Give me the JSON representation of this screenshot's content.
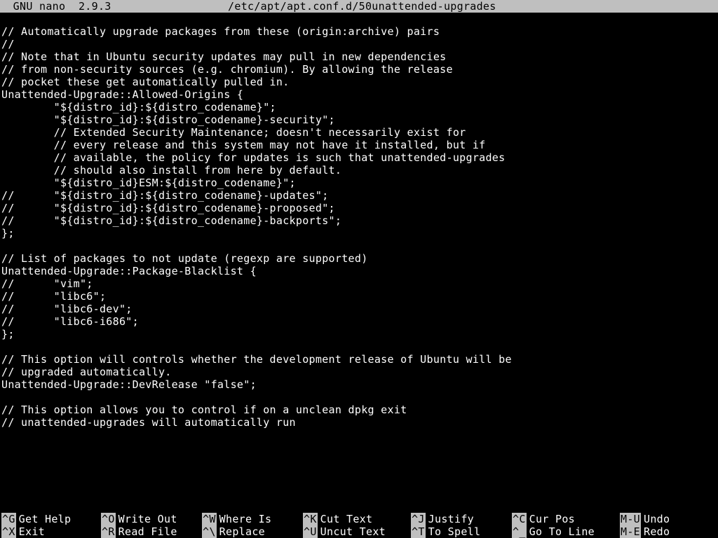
{
  "title": {
    "app": "  GNU nano  2.9.3",
    "filename": "/etc/apt/apt.conf.d/50unattended-upgrades"
  },
  "buffer_lines": [
    "",
    "// Automatically upgrade packages from these (origin:archive) pairs",
    "//",
    "// Note that in Ubuntu security updates may pull in new dependencies",
    "// from non-security sources (e.g. chromium). By allowing the release",
    "// pocket these get automatically pulled in.",
    "Unattended-Upgrade::Allowed-Origins {",
    "        \"${distro_id}:${distro_codename}\";",
    "        \"${distro_id}:${distro_codename}-security\";",
    "        // Extended Security Maintenance; doesn't necessarily exist for",
    "        // every release and this system may not have it installed, but if",
    "        // available, the policy for updates is such that unattended-upgrades",
    "        // should also install from here by default.",
    "        \"${distro_id}ESM:${distro_codename}\";",
    "//      \"${distro_id}:${distro_codename}-updates\";",
    "//      \"${distro_id}:${distro_codename}-proposed\";",
    "//      \"${distro_id}:${distro_codename}-backports\";",
    "};",
    "",
    "// List of packages to not update (regexp are supported)",
    "Unattended-Upgrade::Package-Blacklist {",
    "//      \"vim\";",
    "//      \"libc6\";",
    "//      \"libc6-dev\";",
    "//      \"libc6-i686\";",
    "};",
    "",
    "// This option will controls whether the development release of Ubuntu will be",
    "// upgraded automatically.",
    "Unattended-Upgrade::DevRelease \"false\";",
    "",
    "// This option allows you to control if on a unclean dpkg exit",
    "// unattended-upgrades will automatically run"
  ],
  "shortcuts": {
    "row1": [
      {
        "key": "^G",
        "label": "Get Help"
      },
      {
        "key": "^O",
        "label": "Write Out"
      },
      {
        "key": "^W",
        "label": "Where Is"
      },
      {
        "key": "^K",
        "label": "Cut Text"
      },
      {
        "key": "^J",
        "label": "Justify"
      },
      {
        "key": "^C",
        "label": "Cur Pos"
      },
      {
        "key": "M-U",
        "label": "Undo"
      }
    ],
    "row2": [
      {
        "key": "^X",
        "label": "Exit"
      },
      {
        "key": "^R",
        "label": "Read File"
      },
      {
        "key": "^\\",
        "label": "Replace"
      },
      {
        "key": "^U",
        "label": "Uncut Text"
      },
      {
        "key": "^T",
        "label": "To Spell"
      },
      {
        "key": "^_",
        "label": "Go To Line"
      },
      {
        "key": "M-E",
        "label": "Redo"
      }
    ]
  }
}
